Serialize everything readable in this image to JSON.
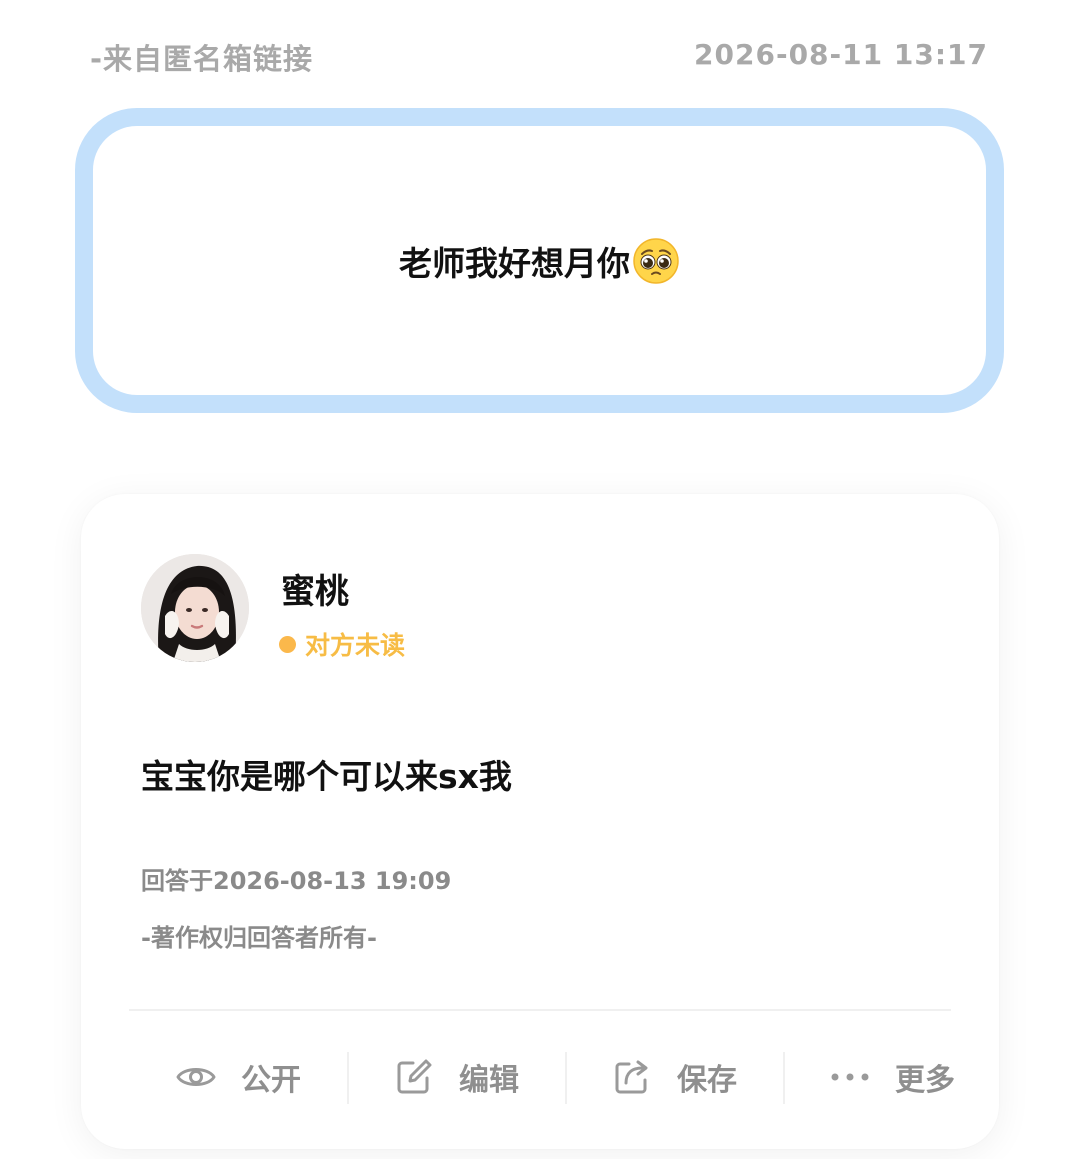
{
  "header": {
    "source": "-来自匿名箱链接",
    "asked_at": "2026-08-11  13:17"
  },
  "question": {
    "text": "老师我好想月你",
    "emoji": "pleading-face-emoji"
  },
  "answer": {
    "user_name": "蜜桃",
    "read_status": "对方未读",
    "status_color": "#fbb84b",
    "text": "宝宝你是哪个可以来sx我",
    "answered_at": "回答于2026-08-13  19:09",
    "copyright": "-著作权归回答者所有-"
  },
  "actions": [
    {
      "label": "公开",
      "icon": "eye-icon"
    },
    {
      "label": "编辑",
      "icon": "edit-icon"
    },
    {
      "label": "保存",
      "icon": "share-icon"
    },
    {
      "label": "更多",
      "icon": "more-icon"
    }
  ],
  "colors": {
    "card_border": "#c3e0fb",
    "meta_text": "#a9a9a9",
    "action_text": "#8f8f8f"
  }
}
